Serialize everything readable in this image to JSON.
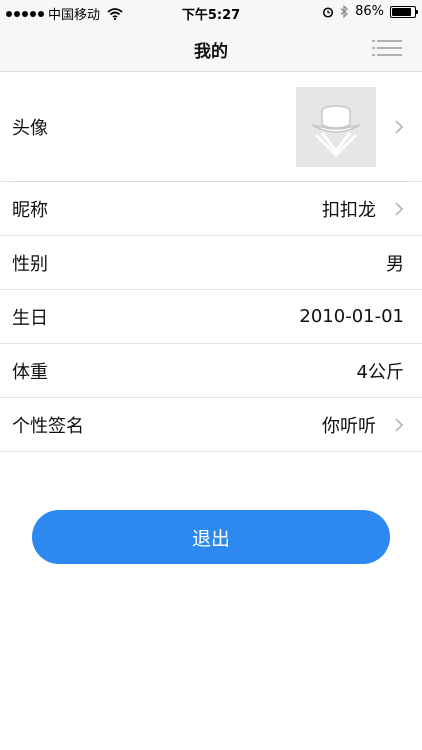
{
  "status_bar": {
    "carrier": "中国移动",
    "time": "下午5:27",
    "battery_text": "86%",
    "battery_level": 0.86
  },
  "nav": {
    "title": "我的"
  },
  "profile": {
    "rows": [
      {
        "label": "头像",
        "value": ""
      },
      {
        "label": "昵称",
        "value": "扣扣龙"
      },
      {
        "label": "性别",
        "value": "男"
      },
      {
        "label": "生日",
        "value": "2010-01-01"
      },
      {
        "label": "体重",
        "value": "4公斤"
      },
      {
        "label": "个性签名",
        "value": "你听听"
      }
    ]
  },
  "actions": {
    "logout_label": "退出"
  },
  "colors": {
    "accent": "#2d89ef",
    "bar_bg": "#f7f7f7",
    "avatar_bg": "#e6e6e6"
  }
}
